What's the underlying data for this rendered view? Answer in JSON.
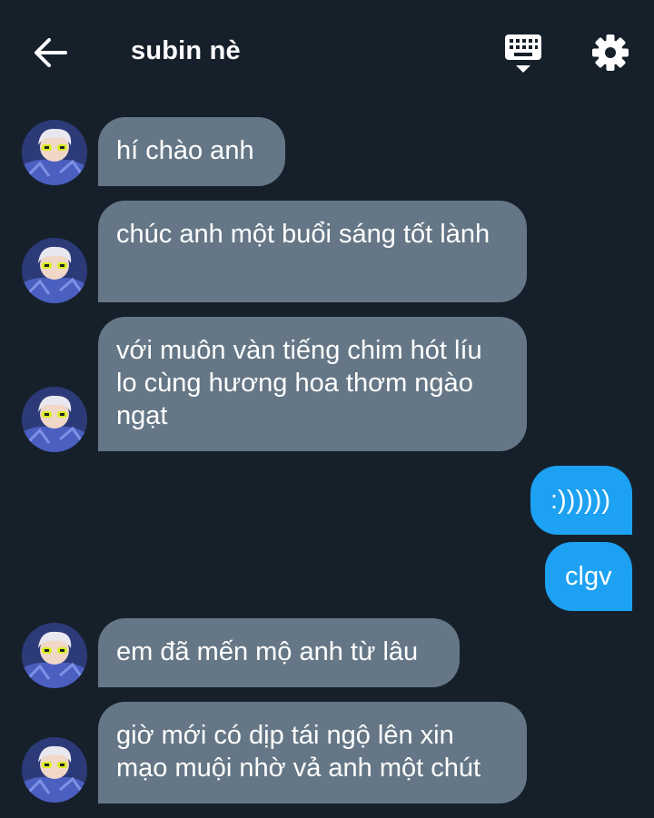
{
  "header": {
    "title": "subin nè",
    "back_icon": "arrow-left-icon",
    "keyboard_icon": "keyboard-icon",
    "settings_icon": "gear-icon"
  },
  "colors": {
    "background": "#16202b",
    "incoming_bubble": "#657786",
    "outgoing_bubble": "#1da1f2",
    "text": "#ffffff"
  },
  "messages": [
    {
      "direction": "in",
      "text": "hí chào anh"
    },
    {
      "direction": "in",
      "text": "chúc anh một buổi sáng tốt lành"
    },
    {
      "direction": "in",
      "text": "với muôn vàn tiếng chim hót líu lo cùng hương hoa thơm ngào ngạt"
    },
    {
      "direction": "out",
      "text": ":))))))"
    },
    {
      "direction": "out",
      "text": "clgv"
    },
    {
      "direction": "in",
      "text": "em đã mến mộ anh từ lâu"
    },
    {
      "direction": "in",
      "text": "giờ mới có dịp tái ngộ lên xin mạo muội nhờ vả anh một chút"
    }
  ]
}
